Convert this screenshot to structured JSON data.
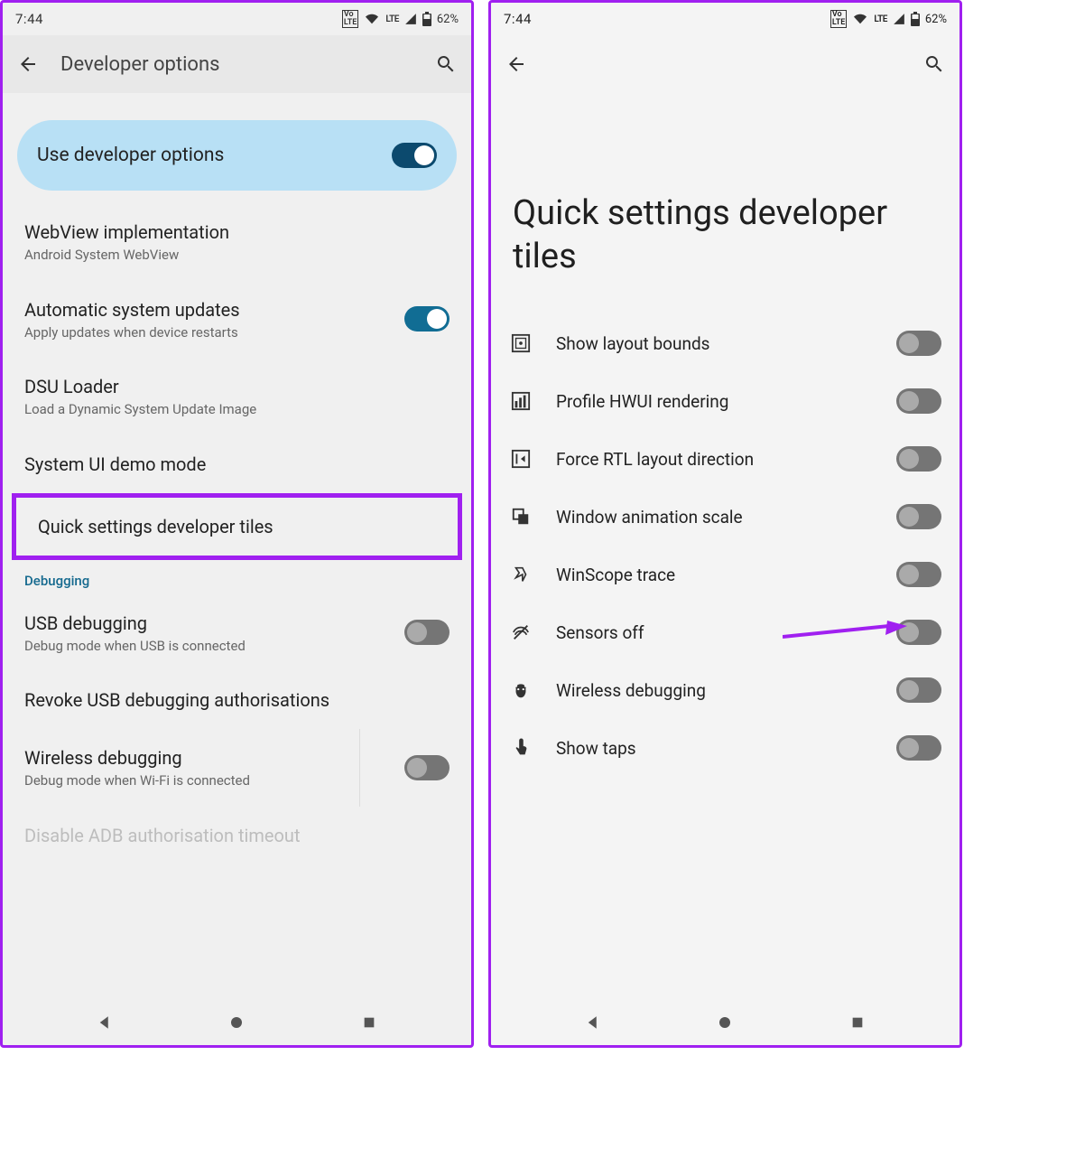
{
  "status": {
    "time": "7:44",
    "volte": "Vo\nLTE",
    "lte": "LTE",
    "battery": "62%"
  },
  "left": {
    "title": "Developer options",
    "master_switch": {
      "label": "Use developer options",
      "on": true
    },
    "items": [
      {
        "title": "WebView implementation",
        "sub": "Android System WebView",
        "toggle": null
      },
      {
        "title": "Automatic system updates",
        "sub": "Apply updates when device restarts",
        "toggle": true
      },
      {
        "title": "DSU Loader",
        "sub": "Load a Dynamic System Update Image",
        "toggle": null
      },
      {
        "title": "System UI demo mode",
        "sub": "",
        "toggle": null
      },
      {
        "title": "Quick settings developer tiles",
        "sub": "",
        "toggle": null,
        "highlight": true
      }
    ],
    "section": "Debugging",
    "debug_items": [
      {
        "title": "USB debugging",
        "sub": "Debug mode when USB is connected",
        "toggle": false
      },
      {
        "title": "Revoke USB debugging authorisations",
        "sub": "",
        "toggle": null
      },
      {
        "title": "Wireless debugging",
        "sub": "Debug mode when Wi-Fi is connected",
        "toggle": false,
        "vdiv": true
      },
      {
        "title": "Disable ADB authorisation timeout",
        "sub": "",
        "toggle": null,
        "disabled": true
      }
    ]
  },
  "right": {
    "title": "Quick settings developer tiles",
    "tiles": [
      {
        "icon": "layout-bounds",
        "label": "Show layout bounds",
        "on": false
      },
      {
        "icon": "profile-hwui",
        "label": "Profile HWUI rendering",
        "on": false
      },
      {
        "icon": "rtl",
        "label": "Force RTL layout direction",
        "on": false
      },
      {
        "icon": "window-anim",
        "label": "Window animation scale",
        "on": false
      },
      {
        "icon": "winscope",
        "label": "WinScope trace",
        "on": false
      },
      {
        "icon": "sensors-off",
        "label": "Sensors off",
        "on": false,
        "arrow": true
      },
      {
        "icon": "wireless-debug",
        "label": "Wireless debugging",
        "on": false
      },
      {
        "icon": "show-taps",
        "label": "Show taps",
        "on": false
      }
    ]
  }
}
